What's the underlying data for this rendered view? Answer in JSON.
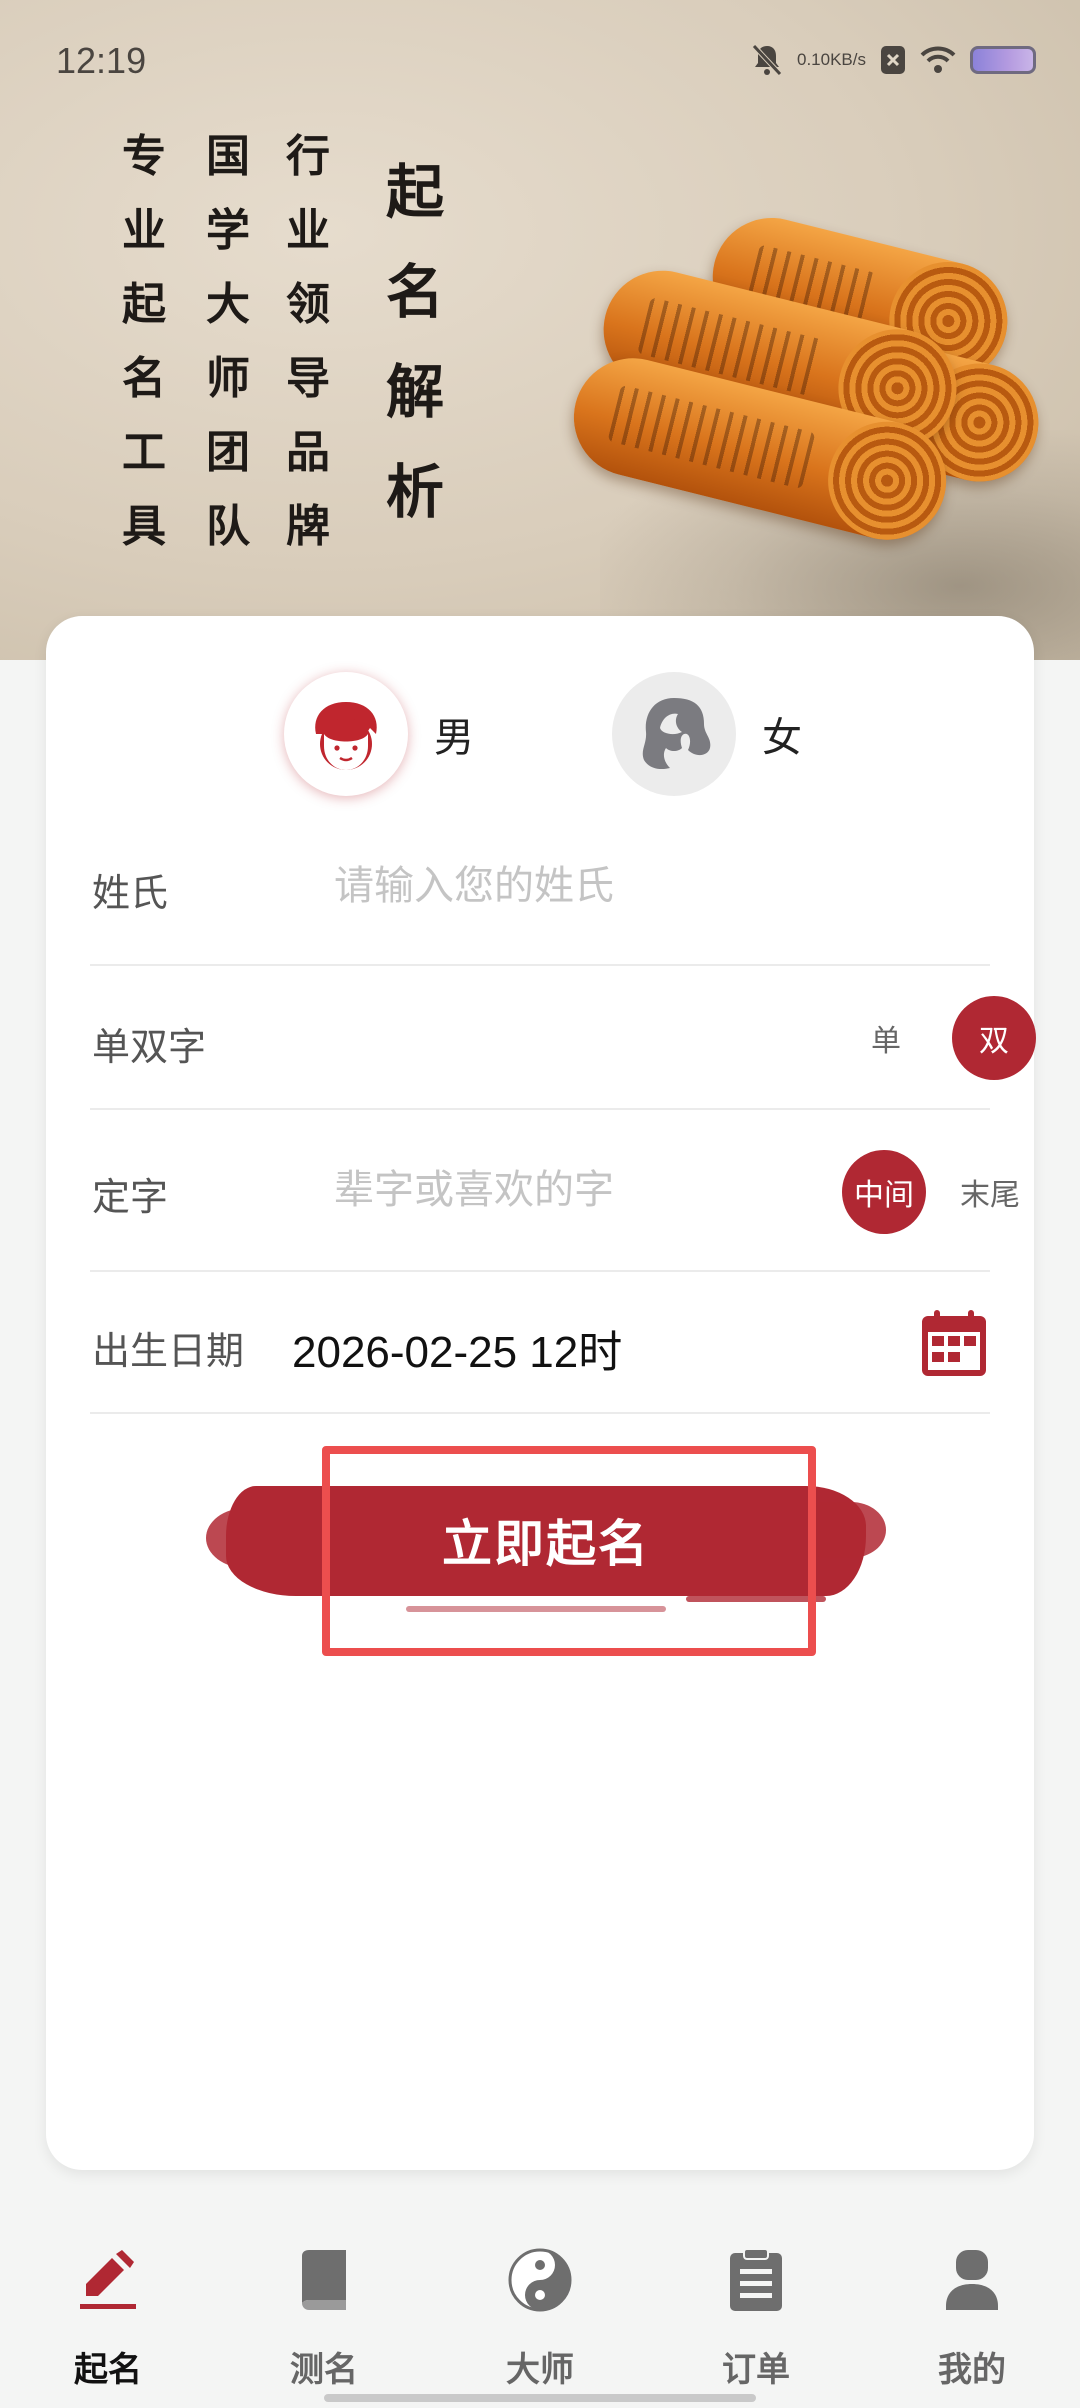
{
  "status_bar": {
    "time": "12:19",
    "net_speed_value": "0.10",
    "net_speed_unit": "KB/s"
  },
  "banner": {
    "calligraphy_columns": [
      [
        "专",
        "业",
        "起",
        "名",
        "工",
        "具"
      ],
      [
        "国",
        "学",
        "大",
        "师",
        "团",
        "队"
      ],
      [
        "行",
        "业",
        "领",
        "导",
        "品",
        "牌"
      ]
    ],
    "calligraphy_title": [
      "起",
      "名",
      "解",
      "析"
    ]
  },
  "gender": {
    "male_label": "男",
    "female_label": "女",
    "selected": "male"
  },
  "form": {
    "surname_label": "姓氏",
    "surname_placeholder": "请输入您的姓氏",
    "surname_value": "",
    "char_count_label": "单双字",
    "char_count_single": "单",
    "char_count_double": "双",
    "char_count_selected": "双",
    "fixed_char_label": "定字",
    "fixed_char_placeholder": "辈字或喜欢的字",
    "fixed_char_value": "",
    "position_middle": "中间",
    "position_end": "末尾",
    "position_selected": "中间",
    "birth_label": "出生日期",
    "birth_value": "2026-02-25 12时"
  },
  "cta": {
    "label": "立即起名"
  },
  "colors": {
    "accent": "#b02833",
    "highlight": "#ec4e4e"
  },
  "nav": {
    "items": [
      {
        "label": "起名",
        "icon": "pencil-icon",
        "active": true
      },
      {
        "label": "测名",
        "icon": "book-icon",
        "active": false
      },
      {
        "label": "大师",
        "icon": "yin-yang-icon",
        "active": false
      },
      {
        "label": "订单",
        "icon": "clipboard-icon",
        "active": false
      },
      {
        "label": "我的",
        "icon": "user-icon",
        "active": false
      }
    ]
  }
}
